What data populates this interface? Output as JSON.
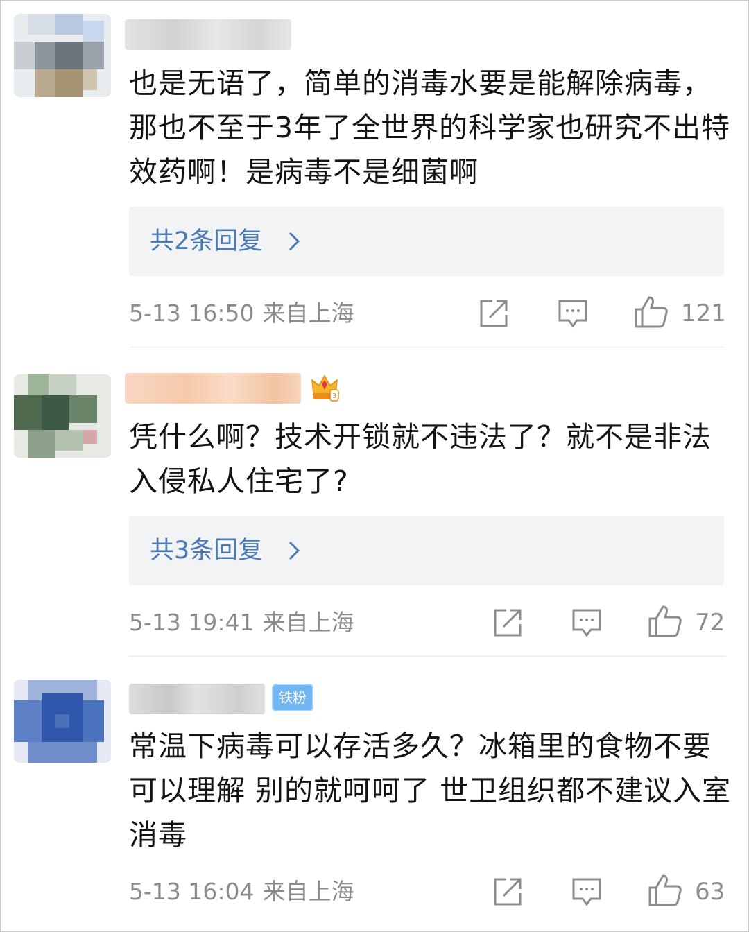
{
  "comments": [
    {
      "username": "",
      "text": "也是无语了，简单的消毒水要是能解除病毒，那也不至于3年了全世界的科学家也研究不出特效药啊！是病毒不是细菌啊",
      "reply_label": "共2条回复",
      "time": "5-13 16:50",
      "location": "来自上海",
      "likes": "121"
    },
    {
      "username": "",
      "badge_icon": "crown-badge-icon",
      "text": "凭什么啊？技术开锁就不违法了？就不是非法入侵私人住宅了?",
      "reply_label": "共3条回复",
      "time": "5-13 19:41",
      "location": "来自上海",
      "likes": "72"
    },
    {
      "username": "",
      "badge_label": "铁粉",
      "text": "常温下病毒可以存活多久？冰箱里的食物不要可以理解  别的就呵呵了  世卫组织都不建议入室消毒",
      "time": "5-13 16:04",
      "location": "来自上海",
      "likes": "63"
    }
  ],
  "colors": {
    "link": "#4a7bb7",
    "meta": "#8c8c8c",
    "reply_bg": "#f2f3f5",
    "fan_badge": "#6fb6f2"
  },
  "icons": [
    "share-icon",
    "comment-icon",
    "like-icon",
    "chevron-right-icon"
  ]
}
